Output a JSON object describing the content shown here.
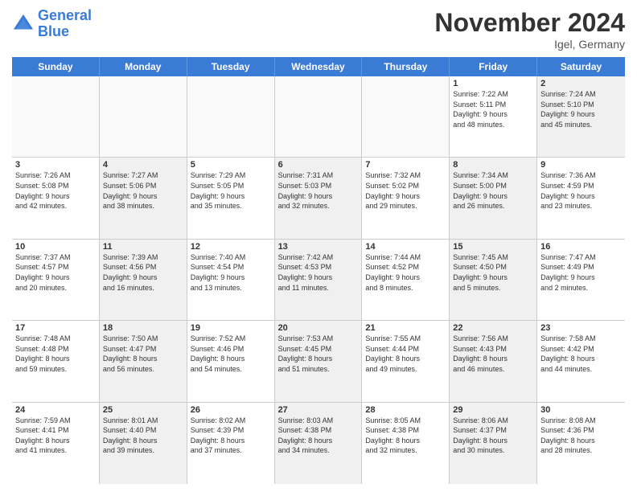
{
  "logo": {
    "line1": "General",
    "line2": "Blue"
  },
  "title": "November 2024",
  "subtitle": "Igel, Germany",
  "header_days": [
    "Sunday",
    "Monday",
    "Tuesday",
    "Wednesday",
    "Thursday",
    "Friday",
    "Saturday"
  ],
  "weeks": [
    [
      {
        "day": "",
        "info": "",
        "shaded": false,
        "empty": true
      },
      {
        "day": "",
        "info": "",
        "shaded": false,
        "empty": true
      },
      {
        "day": "",
        "info": "",
        "shaded": false,
        "empty": true
      },
      {
        "day": "",
        "info": "",
        "shaded": false,
        "empty": true
      },
      {
        "day": "",
        "info": "",
        "shaded": false,
        "empty": true
      },
      {
        "day": "1",
        "info": "Sunrise: 7:22 AM\nSunset: 5:11 PM\nDaylight: 9 hours\nand 48 minutes.",
        "shaded": false,
        "empty": false
      },
      {
        "day": "2",
        "info": "Sunrise: 7:24 AM\nSunset: 5:10 PM\nDaylight: 9 hours\nand 45 minutes.",
        "shaded": true,
        "empty": false
      }
    ],
    [
      {
        "day": "3",
        "info": "Sunrise: 7:26 AM\nSunset: 5:08 PM\nDaylight: 9 hours\nand 42 minutes.",
        "shaded": false,
        "empty": false
      },
      {
        "day": "4",
        "info": "Sunrise: 7:27 AM\nSunset: 5:06 PM\nDaylight: 9 hours\nand 38 minutes.",
        "shaded": true,
        "empty": false
      },
      {
        "day": "5",
        "info": "Sunrise: 7:29 AM\nSunset: 5:05 PM\nDaylight: 9 hours\nand 35 minutes.",
        "shaded": false,
        "empty": false
      },
      {
        "day": "6",
        "info": "Sunrise: 7:31 AM\nSunset: 5:03 PM\nDaylight: 9 hours\nand 32 minutes.",
        "shaded": true,
        "empty": false
      },
      {
        "day": "7",
        "info": "Sunrise: 7:32 AM\nSunset: 5:02 PM\nDaylight: 9 hours\nand 29 minutes.",
        "shaded": false,
        "empty": false
      },
      {
        "day": "8",
        "info": "Sunrise: 7:34 AM\nSunset: 5:00 PM\nDaylight: 9 hours\nand 26 minutes.",
        "shaded": true,
        "empty": false
      },
      {
        "day": "9",
        "info": "Sunrise: 7:36 AM\nSunset: 4:59 PM\nDaylight: 9 hours\nand 23 minutes.",
        "shaded": false,
        "empty": false
      }
    ],
    [
      {
        "day": "10",
        "info": "Sunrise: 7:37 AM\nSunset: 4:57 PM\nDaylight: 9 hours\nand 20 minutes.",
        "shaded": false,
        "empty": false
      },
      {
        "day": "11",
        "info": "Sunrise: 7:39 AM\nSunset: 4:56 PM\nDaylight: 9 hours\nand 16 minutes.",
        "shaded": true,
        "empty": false
      },
      {
        "day": "12",
        "info": "Sunrise: 7:40 AM\nSunset: 4:54 PM\nDaylight: 9 hours\nand 13 minutes.",
        "shaded": false,
        "empty": false
      },
      {
        "day": "13",
        "info": "Sunrise: 7:42 AM\nSunset: 4:53 PM\nDaylight: 9 hours\nand 11 minutes.",
        "shaded": true,
        "empty": false
      },
      {
        "day": "14",
        "info": "Sunrise: 7:44 AM\nSunset: 4:52 PM\nDaylight: 9 hours\nand 8 minutes.",
        "shaded": false,
        "empty": false
      },
      {
        "day": "15",
        "info": "Sunrise: 7:45 AM\nSunset: 4:50 PM\nDaylight: 9 hours\nand 5 minutes.",
        "shaded": true,
        "empty": false
      },
      {
        "day": "16",
        "info": "Sunrise: 7:47 AM\nSunset: 4:49 PM\nDaylight: 9 hours\nand 2 minutes.",
        "shaded": false,
        "empty": false
      }
    ],
    [
      {
        "day": "17",
        "info": "Sunrise: 7:48 AM\nSunset: 4:48 PM\nDaylight: 8 hours\nand 59 minutes.",
        "shaded": false,
        "empty": false
      },
      {
        "day": "18",
        "info": "Sunrise: 7:50 AM\nSunset: 4:47 PM\nDaylight: 8 hours\nand 56 minutes.",
        "shaded": true,
        "empty": false
      },
      {
        "day": "19",
        "info": "Sunrise: 7:52 AM\nSunset: 4:46 PM\nDaylight: 8 hours\nand 54 minutes.",
        "shaded": false,
        "empty": false
      },
      {
        "day": "20",
        "info": "Sunrise: 7:53 AM\nSunset: 4:45 PM\nDaylight: 8 hours\nand 51 minutes.",
        "shaded": true,
        "empty": false
      },
      {
        "day": "21",
        "info": "Sunrise: 7:55 AM\nSunset: 4:44 PM\nDaylight: 8 hours\nand 49 minutes.",
        "shaded": false,
        "empty": false
      },
      {
        "day": "22",
        "info": "Sunrise: 7:56 AM\nSunset: 4:43 PM\nDaylight: 8 hours\nand 46 minutes.",
        "shaded": true,
        "empty": false
      },
      {
        "day": "23",
        "info": "Sunrise: 7:58 AM\nSunset: 4:42 PM\nDaylight: 8 hours\nand 44 minutes.",
        "shaded": false,
        "empty": false
      }
    ],
    [
      {
        "day": "24",
        "info": "Sunrise: 7:59 AM\nSunset: 4:41 PM\nDaylight: 8 hours\nand 41 minutes.",
        "shaded": false,
        "empty": false
      },
      {
        "day": "25",
        "info": "Sunrise: 8:01 AM\nSunset: 4:40 PM\nDaylight: 8 hours\nand 39 minutes.",
        "shaded": true,
        "empty": false
      },
      {
        "day": "26",
        "info": "Sunrise: 8:02 AM\nSunset: 4:39 PM\nDaylight: 8 hours\nand 37 minutes.",
        "shaded": false,
        "empty": false
      },
      {
        "day": "27",
        "info": "Sunrise: 8:03 AM\nSunset: 4:38 PM\nDaylight: 8 hours\nand 34 minutes.",
        "shaded": true,
        "empty": false
      },
      {
        "day": "28",
        "info": "Sunrise: 8:05 AM\nSunset: 4:38 PM\nDaylight: 8 hours\nand 32 minutes.",
        "shaded": false,
        "empty": false
      },
      {
        "day": "29",
        "info": "Sunrise: 8:06 AM\nSunset: 4:37 PM\nDaylight: 8 hours\nand 30 minutes.",
        "shaded": true,
        "empty": false
      },
      {
        "day": "30",
        "info": "Sunrise: 8:08 AM\nSunset: 4:36 PM\nDaylight: 8 hours\nand 28 minutes.",
        "shaded": false,
        "empty": false
      }
    ]
  ]
}
